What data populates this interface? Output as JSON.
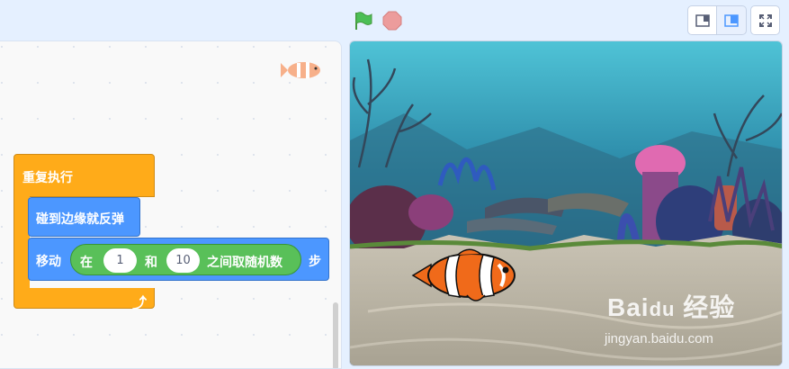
{
  "toolbar": {
    "icons": [
      "green-flag-icon",
      "stop-icon",
      "small-stage-icon",
      "normal-stage-icon",
      "fullscreen-icon"
    ]
  },
  "blocks": {
    "repeat_label": "重复执行",
    "bounce_label": "碰到边缘就反弹",
    "move_label": "移动",
    "move_unit": "步",
    "random": {
      "prefix": "在",
      "from": "1",
      "and": "和",
      "to": "10",
      "suffix": "之间取随机数"
    }
  },
  "watermark": {
    "logo": "Bai du 经验",
    "url": "jingyan.baidu.com"
  },
  "colors": {
    "control": "#ffab19",
    "motion": "#4c97ff",
    "operators": "#59c059",
    "flag": "#4cbf56",
    "stop": "#ec9c9c"
  }
}
